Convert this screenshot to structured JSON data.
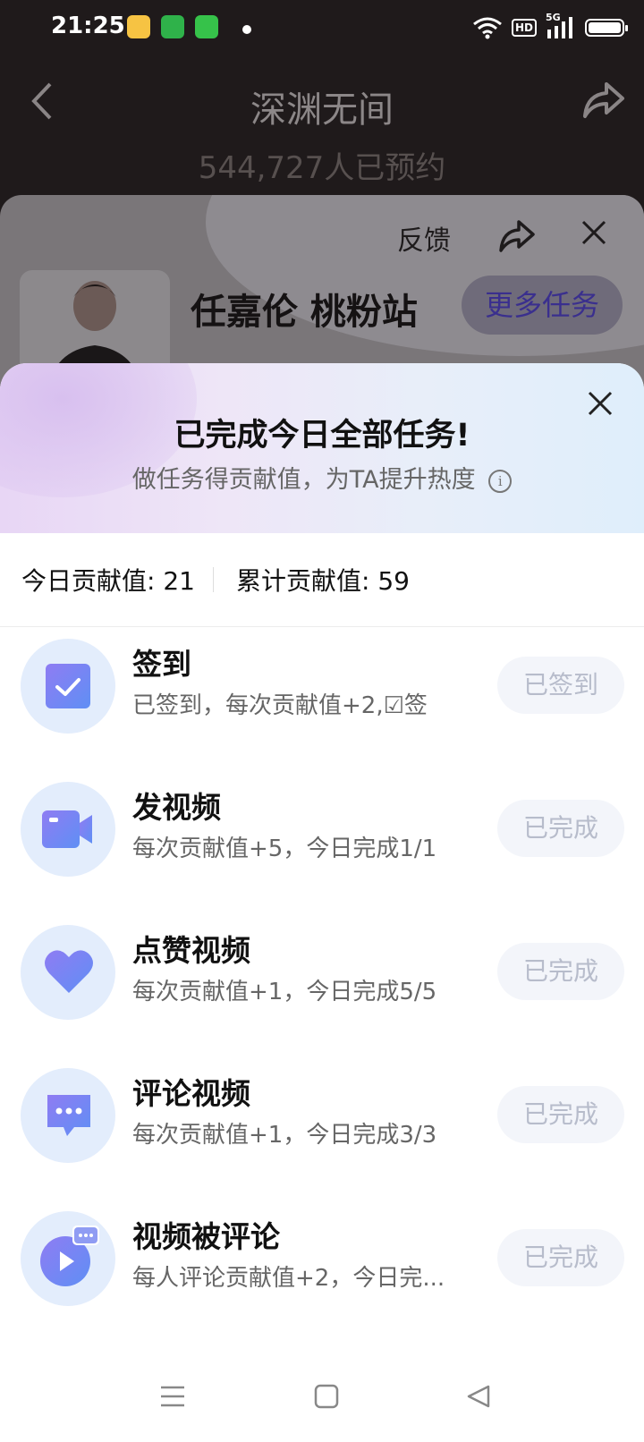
{
  "status_bar": {
    "time": "21:25",
    "hd": "HD",
    "network": "5G"
  },
  "header": {
    "title": "深渊无间",
    "reservations": "544,727人已预约"
  },
  "profile_card": {
    "feedback": "反馈",
    "name": "任嘉伦 桃粉站",
    "more_tasks": "更多任务"
  },
  "sheet": {
    "title": "已完成今日全部任务!",
    "subtitle": "做任务得贡献值，为TA提升热度",
    "today_contribution": "今日贡献值: 21",
    "total_contribution": "累计贡献值: 59"
  },
  "tasks": [
    {
      "icon": "checkbox-icon",
      "title": "签到",
      "desc": "已签到，每次贡献值+2,☑签",
      "button": "已签到"
    },
    {
      "icon": "video-camera-icon",
      "title": "发视频",
      "desc": "每次贡献值+5，今日完成1/1",
      "button": "已完成"
    },
    {
      "icon": "heart-icon",
      "title": "点赞视频",
      "desc": "每次贡献值+1，今日完成5/5",
      "button": "已完成"
    },
    {
      "icon": "comment-bubble-icon",
      "title": "评论视频",
      "desc": "每次贡献值+1，今日完成3/3",
      "button": "已完成"
    },
    {
      "icon": "play-comment-icon",
      "title": "视频被评论",
      "desc": "每人评论贡献值+2，今日完...",
      "button": "已完成"
    }
  ],
  "colors": {
    "accent": "#6f74f0",
    "icon_bg": "#e3edfc",
    "button_bg": "#f3f5fa",
    "button_text": "#b7bccb"
  }
}
